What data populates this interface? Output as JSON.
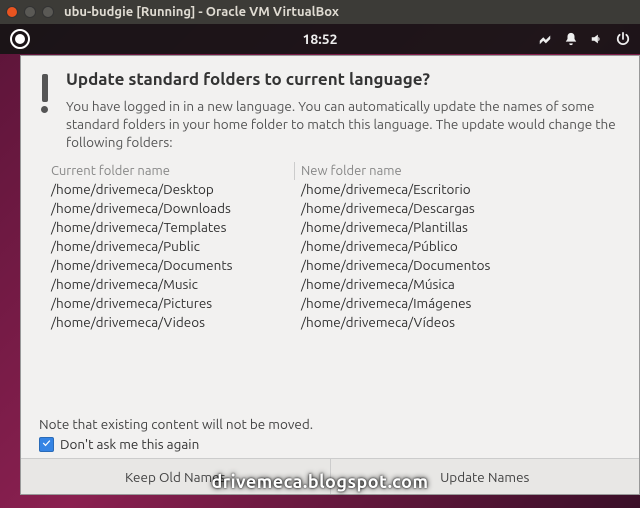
{
  "vbox": {
    "title": "ubu-budgie [Running] - Oracle VM VirtualBox"
  },
  "panel": {
    "clock": "18:52"
  },
  "dialog": {
    "heading": "Update standard folders to current language?",
    "body": "You have logged in in a new language. You can automatically update the names of some standard folders in your home folder to match this language. The update would change the following folders:",
    "col1_header": "Current folder name",
    "col2_header": "New folder name",
    "rows": [
      {
        "current": "/home/drivemeca/Desktop",
        "new": "/home/drivemeca/Escritorio"
      },
      {
        "current": "/home/drivemeca/Downloads",
        "new": "/home/drivemeca/Descargas"
      },
      {
        "current": "/home/drivemeca/Templates",
        "new": "/home/drivemeca/Plantillas"
      },
      {
        "current": "/home/drivemeca/Public",
        "new": "/home/drivemeca/Público"
      },
      {
        "current": "/home/drivemeca/Documents",
        "new": "/home/drivemeca/Documentos"
      },
      {
        "current": "/home/drivemeca/Music",
        "new": "/home/drivemeca/Música"
      },
      {
        "current": "/home/drivemeca/Pictures",
        "new": "/home/drivemeca/Imágenes"
      },
      {
        "current": "/home/drivemeca/Videos",
        "new": "/home/drivemeca/Vídeos"
      }
    ],
    "note": "Note that existing content will not be moved.",
    "checkbox_label": "Don't ask me this again",
    "keep_button": "Keep Old Names",
    "update_button": "Update Names"
  },
  "watermark": "drivemeca.blogspot.com"
}
